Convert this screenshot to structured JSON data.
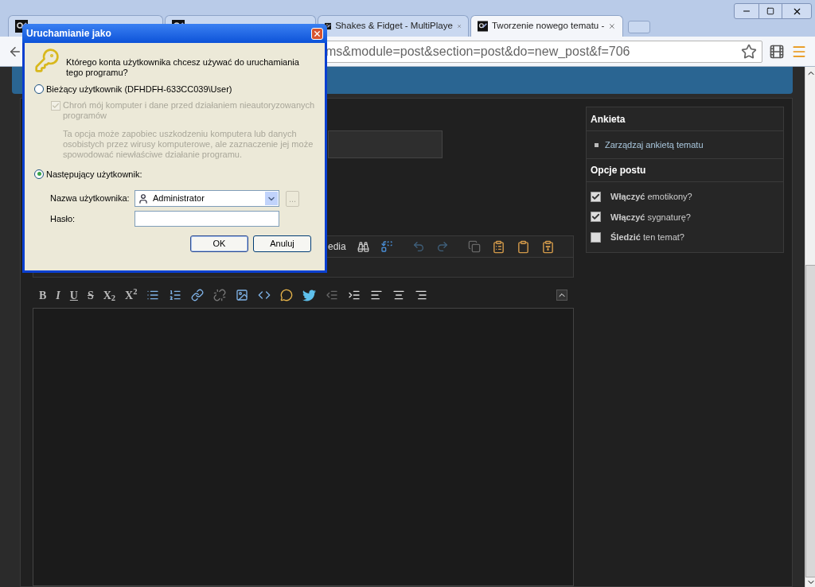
{
  "browser": {
    "tabs": [
      {
        "selected": false
      },
      {
        "selected": false
      },
      {
        "title": "Shakes & Fidget - MultiPlaye",
        "selected": false
      },
      {
        "title": "Tworzenie nowego tematu -",
        "selected": true
      }
    ],
    "address": "ms&module=post&section=post&do=new_post&f=706"
  },
  "editor": {
    "toolbar_text": "edia",
    "format_buttons": [
      "B",
      "I",
      "U",
      "S",
      "X$_{2}$",
      "X$^{2}$"
    ]
  },
  "sidebar": {
    "poll": {
      "title": "Ankieta",
      "link": "Zarządzaj ankietą tematu"
    },
    "options": {
      "title": "Opcje postu",
      "items": [
        {
          "text": "**Włączyć** emotikony?",
          "checked": true
        },
        {
          "text": "**Włączyć** sygnaturę?",
          "checked": true
        },
        {
          "text": "**Śledzić** ten temat?",
          "checked": false
        }
      ]
    }
  },
  "dialog": {
    "title": "Uruchamianie jako",
    "question": "Którego konta użytkownika chcesz używać do uruchamiania tego programu?",
    "choices": [
      {
        "label": "Bieżący użytkownik (DFHDFH-633CC039\\User)",
        "selected": false
      },
      {
        "label": "Następujący użytkownik:",
        "selected": true
      }
    ],
    "protect": {
      "label": "Chroń mój komputer i dane przed działaniem nieautoryzowanych programów",
      "checked": true,
      "disabled": true
    },
    "note": "Ta opcja może zapobiec uszkodzeniu komputera lub danych osobistych przez wirusy komputerowe, ale zaznaczenie jej może spowodować niewłaściwe działanie programu.",
    "username_label": "Nazwa użytkownika:",
    "username": "Administrator",
    "password_label": "Hasło:",
    "browse": "...",
    "buttons": [
      "OK",
      "Anuluj"
    ]
  }
}
